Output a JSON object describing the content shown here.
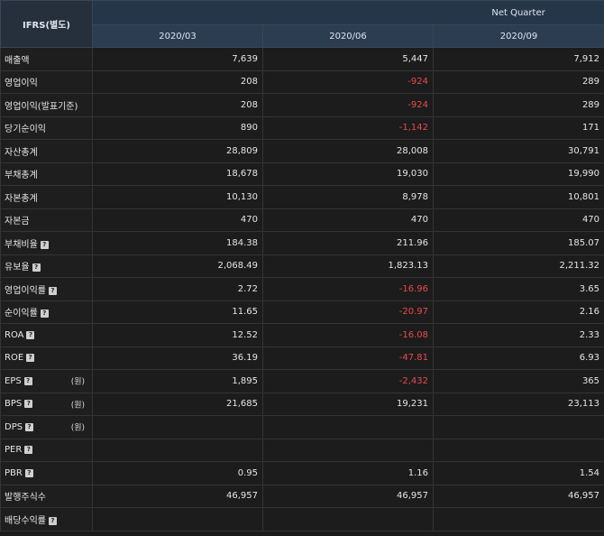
{
  "header": {
    "corner": "IFRS(별도)",
    "group": "Net Quarter",
    "periods": [
      "2020/03",
      "2020/06",
      "2020/09"
    ]
  },
  "colors": {
    "negative": "#e84b4b",
    "header_bg": "#263649",
    "bg": "#1b1b1b"
  },
  "rows": [
    {
      "label": "매출액",
      "help": false,
      "unit": "",
      "values": [
        "7,639",
        "5,447",
        "7,912"
      ]
    },
    {
      "label": "영업이익",
      "help": false,
      "unit": "",
      "values": [
        "208",
        "-924",
        "289"
      ]
    },
    {
      "label": "영업이익(발표기준)",
      "help": false,
      "unit": "",
      "values": [
        "208",
        "-924",
        "289"
      ]
    },
    {
      "label": "당기순이익",
      "help": false,
      "unit": "",
      "values": [
        "890",
        "-1,142",
        "171"
      ]
    },
    {
      "label": "자산총계",
      "help": false,
      "unit": "",
      "values": [
        "28,809",
        "28,008",
        "30,791"
      ]
    },
    {
      "label": "부채총계",
      "help": false,
      "unit": "",
      "values": [
        "18,678",
        "19,030",
        "19,990"
      ]
    },
    {
      "label": "자본총계",
      "help": false,
      "unit": "",
      "values": [
        "10,130",
        "8,978",
        "10,801"
      ]
    },
    {
      "label": "자본금",
      "help": false,
      "unit": "",
      "values": [
        "470",
        "470",
        "470"
      ]
    },
    {
      "label": "부채비율",
      "help": true,
      "unit": "",
      "values": [
        "184.38",
        "211.96",
        "185.07"
      ]
    },
    {
      "label": "유보율",
      "help": true,
      "unit": "",
      "values": [
        "2,068.49",
        "1,823.13",
        "2,211.32"
      ]
    },
    {
      "label": "영업이익률",
      "help": true,
      "unit": "",
      "values": [
        "2.72",
        "-16.96",
        "3.65"
      ]
    },
    {
      "label": "순이익률",
      "help": true,
      "unit": "",
      "values": [
        "11.65",
        "-20.97",
        "2.16"
      ]
    },
    {
      "label": "ROA",
      "help": true,
      "unit": "",
      "values": [
        "12.52",
        "-16.08",
        "2.33"
      ]
    },
    {
      "label": "ROE",
      "help": true,
      "unit": "",
      "values": [
        "36.19",
        "-47.81",
        "6.93"
      ]
    },
    {
      "label": "EPS",
      "help": true,
      "unit": "(원)",
      "values": [
        "1,895",
        "-2,432",
        "365"
      ]
    },
    {
      "label": "BPS",
      "help": true,
      "unit": "(원)",
      "values": [
        "21,685",
        "19,231",
        "23,113"
      ]
    },
    {
      "label": "DPS",
      "help": true,
      "unit": "(원)",
      "values": [
        "",
        "",
        ""
      ]
    },
    {
      "label": "PER",
      "help": true,
      "unit": "",
      "values": [
        "",
        "",
        ""
      ]
    },
    {
      "label": "PBR",
      "help": true,
      "unit": "",
      "values": [
        "0.95",
        "1.16",
        "1.54"
      ]
    },
    {
      "label": "발행주식수",
      "help": false,
      "unit": "",
      "values": [
        "46,957",
        "46,957",
        "46,957"
      ]
    },
    {
      "label": "배당수익률",
      "help": true,
      "unit": "",
      "values": [
        "",
        "",
        ""
      ]
    }
  ],
  "help_glyph": "?"
}
